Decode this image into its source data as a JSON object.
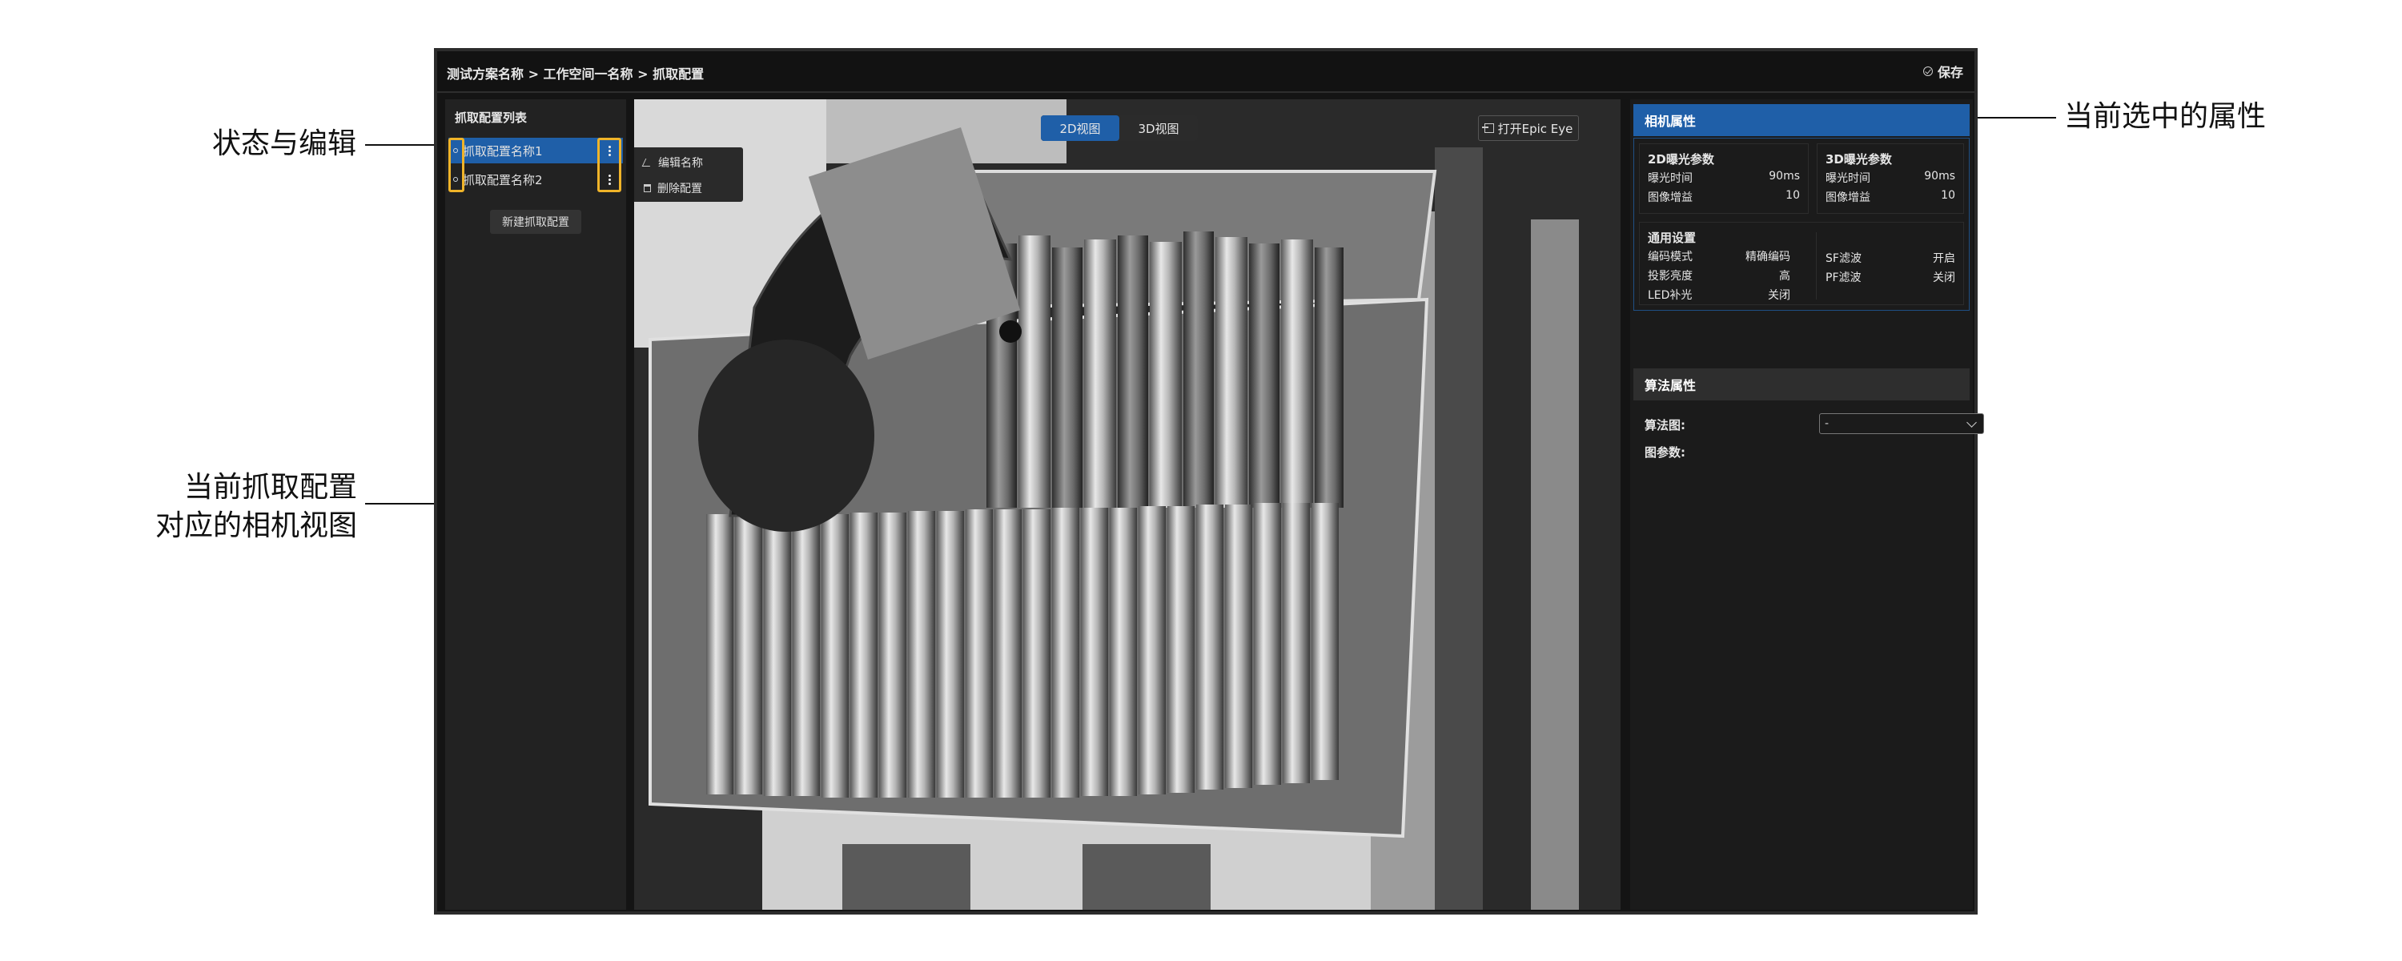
{
  "annotations": {
    "status_edit": "状态与编辑",
    "camera_view_line1": "当前抓取配置",
    "camera_view_line2": "对应的相机视图",
    "selected_props": "当前选中的属性"
  },
  "topbar": {
    "breadcrumb": "测试方案名称 > 工作空间一名称 > 抓取配置",
    "save_label": "保存"
  },
  "left_panel": {
    "title": "抓取配置列表",
    "items": [
      {
        "label": "抓取配置名称1",
        "active": true
      },
      {
        "label": "抓取配置名称2",
        "active": false
      }
    ],
    "new_button": "新建抓取配置"
  },
  "camera_view": {
    "tabs": [
      {
        "label": "2D视图",
        "active": true
      },
      {
        "label": "3D视图",
        "active": false
      }
    ],
    "open_epic_eye": "打开Epic Eye",
    "context_menu": [
      "编辑名称",
      "删除配置"
    ]
  },
  "right_panel": {
    "camera_title": "相机属性",
    "params_2d": {
      "title": "2D曝光参数",
      "rows": [
        {
          "label": "曝光时间",
          "value": "90ms"
        },
        {
          "label": "图像增益",
          "value": "10"
        }
      ]
    },
    "params_3d": {
      "title": "3D曝光参数",
      "rows": [
        {
          "label": "曝光时间",
          "value": "90ms"
        },
        {
          "label": "图像增益",
          "value": "10"
        }
      ]
    },
    "general": {
      "title": "通用设置",
      "left_rows": [
        {
          "label": "编码模式",
          "value": "精确编码"
        },
        {
          "label": "投影亮度",
          "value": "高"
        },
        {
          "label": "LED补光",
          "value": "关闭"
        }
      ],
      "right_rows": [
        {
          "label": "SF滤波",
          "value": "开启"
        },
        {
          "label": "PF滤波",
          "value": "关闭"
        }
      ]
    },
    "algo_title": "算法属性",
    "algo_graph_label": "算法图:",
    "algo_graph_value": "-",
    "graph_params_label": "图参数:"
  },
  "colors": {
    "accent": "#1f5fa8",
    "highlight": "#f0b429",
    "background": "#141414"
  }
}
